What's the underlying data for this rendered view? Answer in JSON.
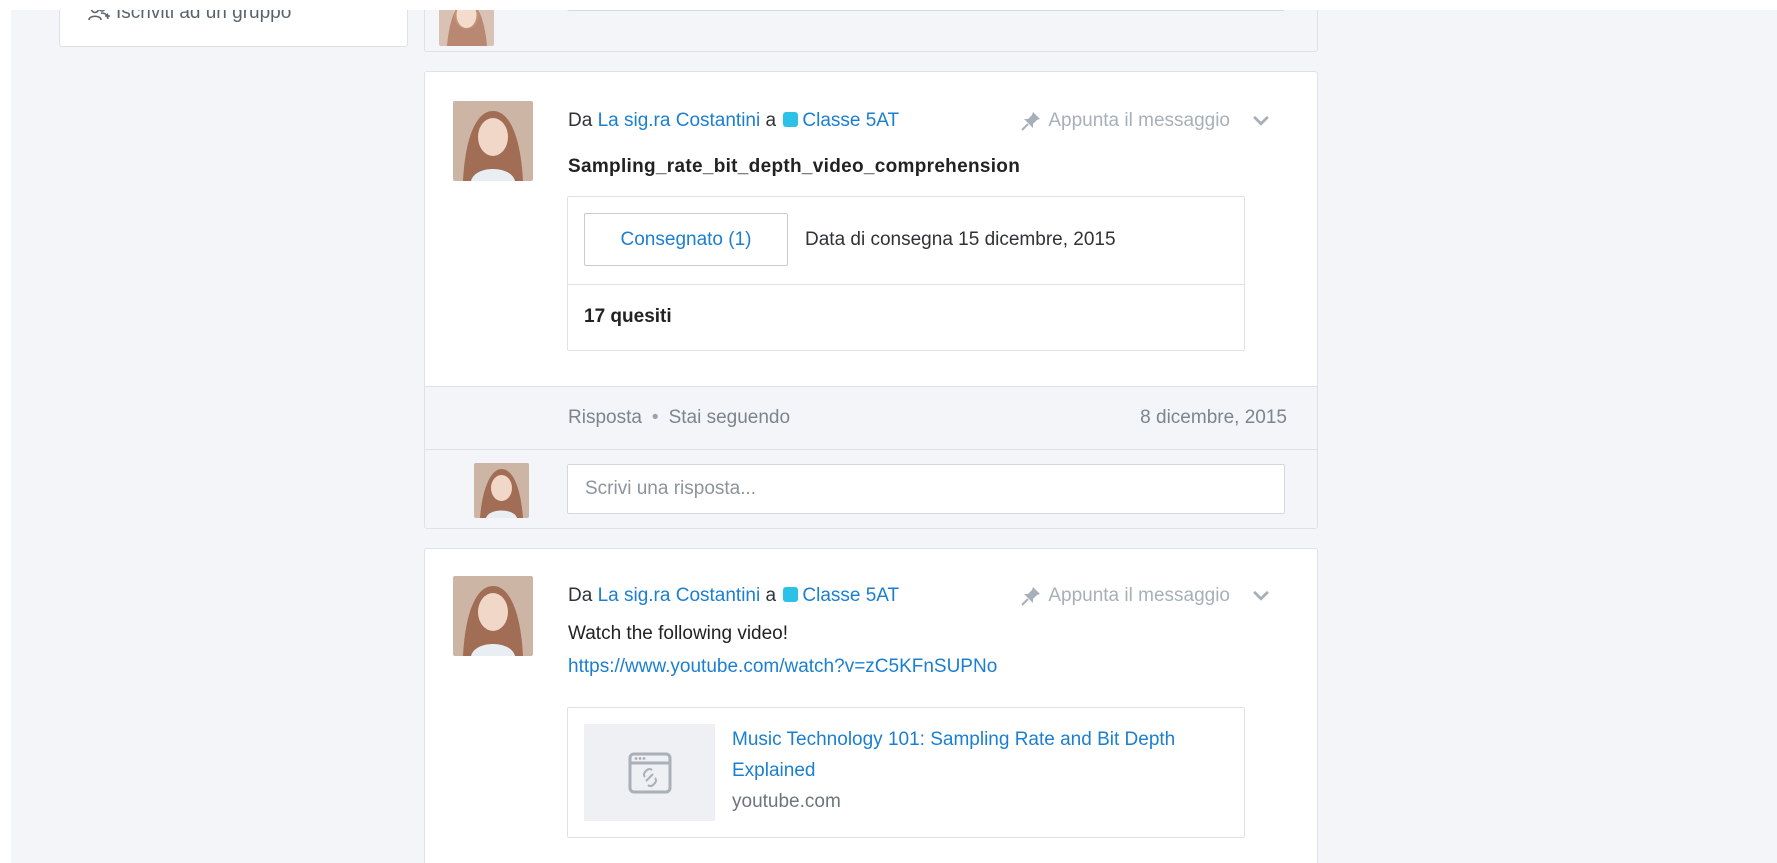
{
  "sidebar": {
    "join_group_label": "Iscriviti ad un gruppo"
  },
  "reply_placeholder": "Scrivi una risposta...",
  "posts": [
    {
      "from_prefix": "Da",
      "author": "La sig.ra Costantini",
      "to_word": "a",
      "group": "Classe 5AT",
      "pin_label": "Appunta il messaggio",
      "title": "Sampling_rate_bit_depth_video_comprehension",
      "assignment": {
        "turned_in_label": "Consegnato (1)",
        "due_date": "Data di consegna 15 dicembre, 2015",
        "question_count": "17 quesiti"
      },
      "footer": {
        "reply_label": "Risposta",
        "separator": "•",
        "following_label": "Stai seguendo",
        "date": "8 dicembre, 2015"
      }
    },
    {
      "from_prefix": "Da",
      "author": "La sig.ra Costantini",
      "to_word": "a",
      "group": "Classe 5AT",
      "pin_label": "Appunta il messaggio",
      "body": "Watch the following video!",
      "link": "https://www.youtube.com/watch?v=zC5KFnSUPNo",
      "preview": {
        "title": "Music Technology 101: Sampling Rate and Bit Depth Explained",
        "domain": "youtube.com"
      }
    }
  ],
  "colors": {
    "link": "#1b7fd1",
    "group_square": "#2cc1e6",
    "page_background": "#f3f5f8"
  },
  "icons": [
    "group-join-icon",
    "pin-icon",
    "chevron-down-icon",
    "link-placeholder-icon"
  ]
}
